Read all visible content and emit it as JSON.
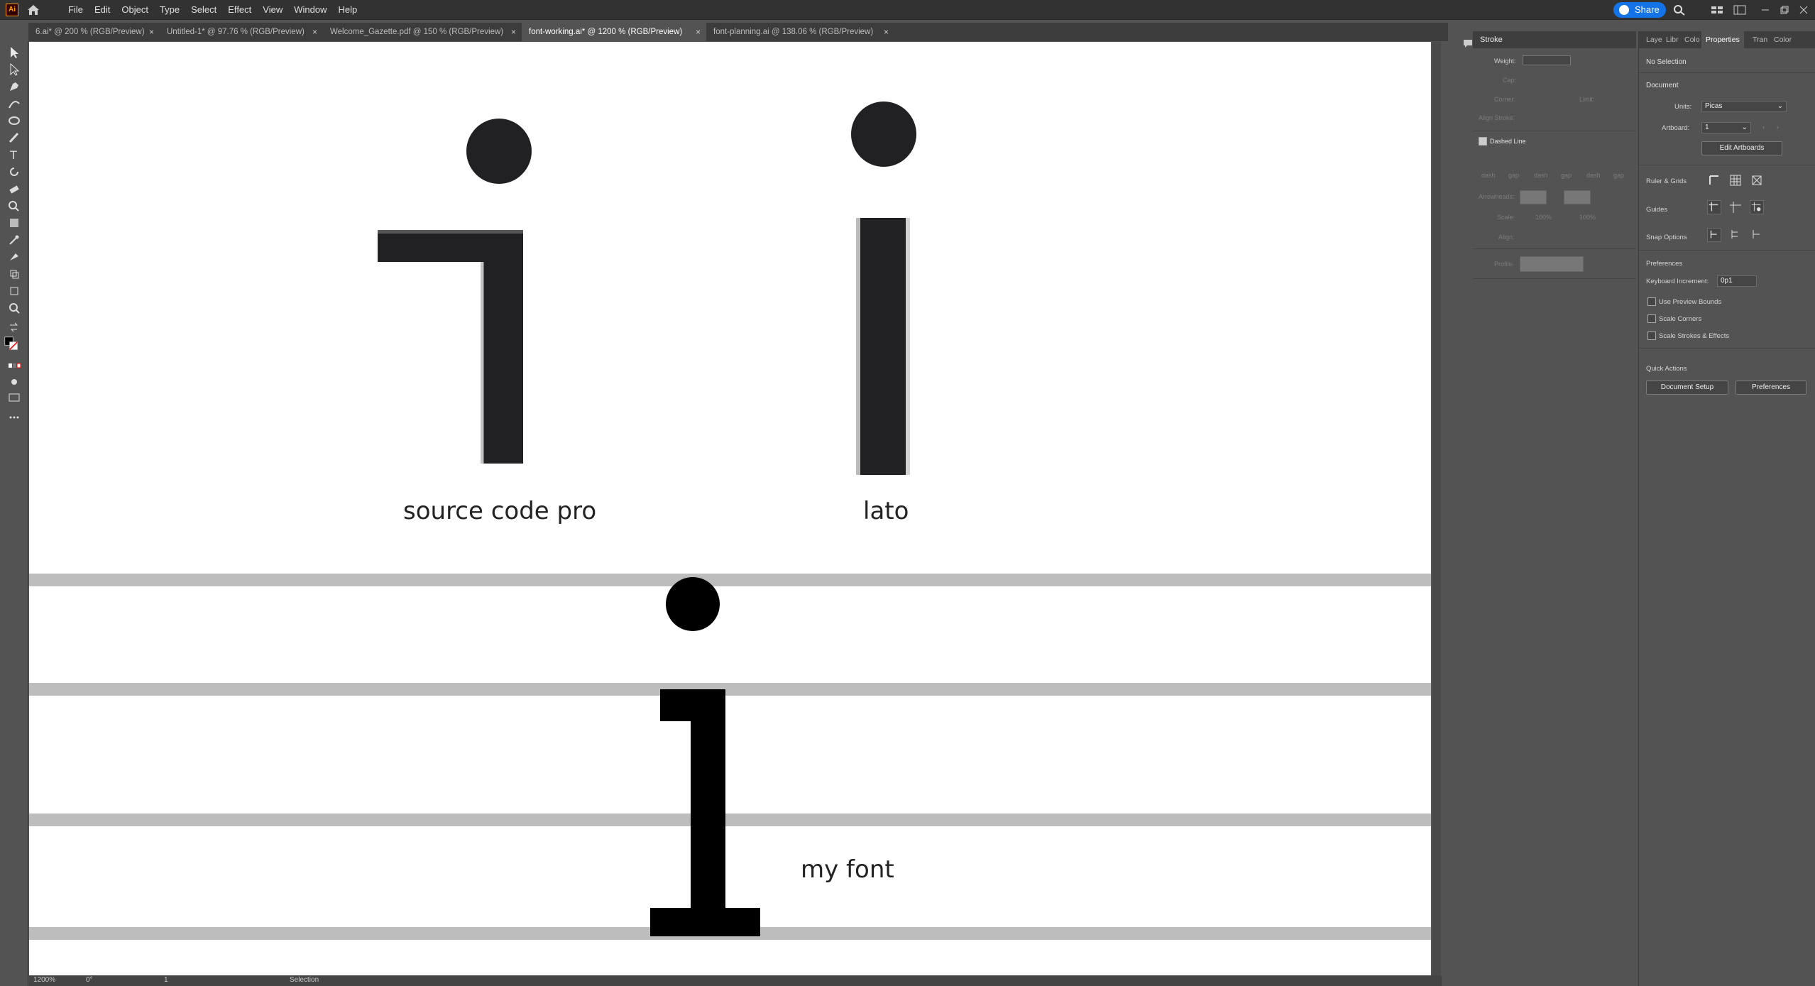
{
  "app": {
    "logo_text": "Ai",
    "menu": [
      "File",
      "Edit",
      "Object",
      "Type",
      "Select",
      "Effect",
      "View",
      "Window",
      "Help"
    ],
    "share_label": "Share"
  },
  "tabs": [
    {
      "label": "6.ai* @ 200 % (RGB/Preview)",
      "active": false
    },
    {
      "label": "Untitled-1* @ 97.76 % (RGB/Preview)",
      "active": false
    },
    {
      "label": "Welcome_Gazette.pdf @ 150 % (RGB/Preview)",
      "active": false
    },
    {
      "label": "font-working.ai* @ 1200 % (RGB/Preview)",
      "active": true
    },
    {
      "label": "font-planning.ai @ 138.06 % (RGB/Preview)",
      "active": false
    }
  ],
  "tab_close": "×",
  "canvas": {
    "label_source_code_pro": "source code pro",
    "label_lato": "lato",
    "label_my_font": "my font"
  },
  "status": {
    "zoom": "1200%",
    "rotation": "0°",
    "artboard": "1",
    "tool": "Selection"
  },
  "stroke_panel": {
    "title": "Stroke",
    "weight_label": "Weight:",
    "cap_label": "Cap:",
    "corner_label": "Corner:",
    "limit_label": "Limit:",
    "align_label": "Align Stroke:",
    "dashed_label": "Dashed Line",
    "dash_labels": [
      "dash",
      "gap",
      "dash",
      "gap",
      "dash",
      "gap"
    ],
    "arrowheads_label": "Arrowheads:",
    "scale_label": "Scale:",
    "scale_values": [
      "100%",
      "100%"
    ],
    "align2_label": "Align:",
    "profile_label": "Profile:"
  },
  "properties": {
    "tabs": [
      "Laye",
      "Libr",
      "Colo",
      "Properties",
      "Tran",
      "Color"
    ],
    "no_selection": "No Selection",
    "document_title": "Document",
    "units_label": "Units:",
    "units_value": "Picas",
    "artboard_label": "Artboard:",
    "artboard_value": "1",
    "edit_artboards": "Edit Artboards",
    "ruler_grids": "Ruler & Grids",
    "guides": "Guides",
    "snap_options": "Snap Options",
    "preferences_title": "Preferences",
    "keyboard_increment_label": "Keyboard Increment:",
    "keyboard_increment_value": "0p1",
    "use_preview_bounds": "Use Preview Bounds",
    "scale_corners": "Scale Corners",
    "scale_strokes": "Scale Strokes & Effects",
    "quick_actions": "Quick Actions",
    "document_setup": "Document Setup",
    "preferences_btn": "Preferences"
  }
}
